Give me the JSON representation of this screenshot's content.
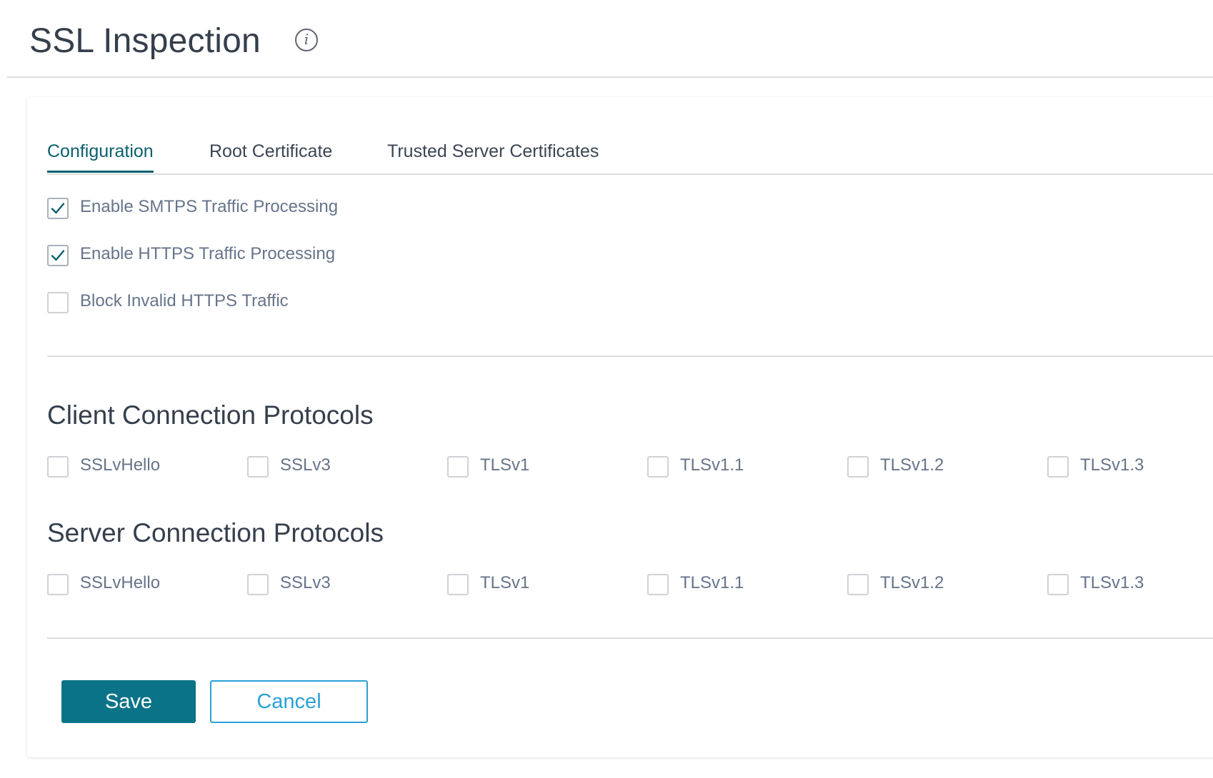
{
  "header": {
    "title": "SSL Inspection",
    "info_icon": "info-icon"
  },
  "tabs": [
    {
      "label": "Configuration",
      "active": true
    },
    {
      "label": "Root Certificate",
      "active": false
    },
    {
      "label": "Trusted Server Certificates",
      "active": false
    }
  ],
  "options": [
    {
      "label": "Enable SMTPS Traffic Processing",
      "checked": true
    },
    {
      "label": "Enable HTTPS Traffic Processing",
      "checked": true
    },
    {
      "label": "Block Invalid HTTPS Traffic",
      "checked": false
    }
  ],
  "client_protocols": {
    "title": "Client Connection Protocols",
    "items": [
      {
        "label": "SSLvHello",
        "checked": false
      },
      {
        "label": "SSLv3",
        "checked": false
      },
      {
        "label": "TLSv1",
        "checked": false
      },
      {
        "label": "TLSv1.1",
        "checked": false
      },
      {
        "label": "TLSv1.2",
        "checked": false
      },
      {
        "label": "TLSv1.3",
        "checked": false
      }
    ]
  },
  "server_protocols": {
    "title": "Server Connection Protocols",
    "items": [
      {
        "label": "SSLvHello",
        "checked": false
      },
      {
        "label": "SSLv3",
        "checked": false
      },
      {
        "label": "TLSv1",
        "checked": false
      },
      {
        "label": "TLSv1.1",
        "checked": false
      },
      {
        "label": "TLSv1.2",
        "checked": false
      },
      {
        "label": "TLSv1.3",
        "checked": false
      }
    ]
  },
  "actions": {
    "save_label": "Save",
    "cancel_label": "Cancel"
  },
  "colors": {
    "accent": "#0a5f6e",
    "primary_button": "#0b7388",
    "secondary_button": "#2aa0d7",
    "label_text": "#66748a"
  }
}
